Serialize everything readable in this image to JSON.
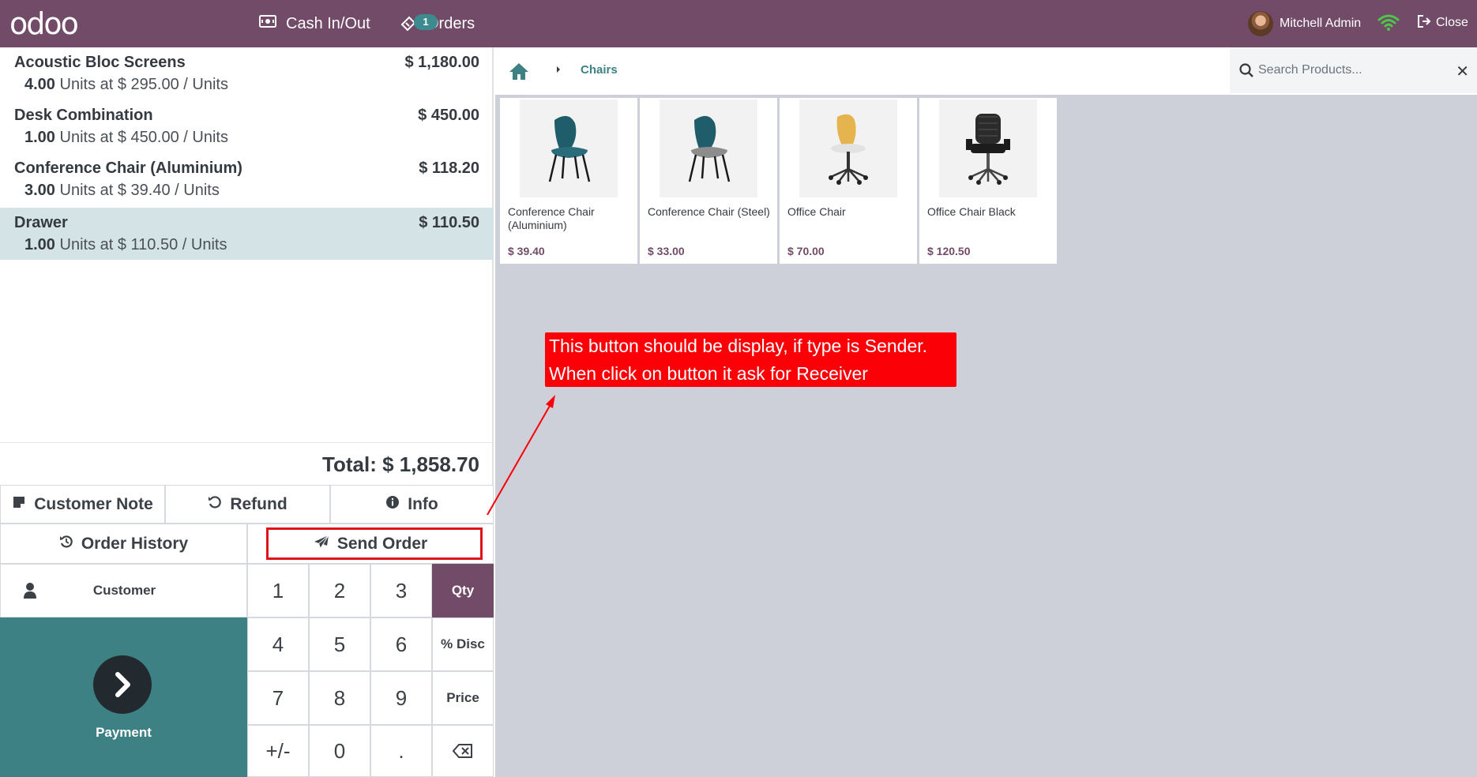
{
  "topbar": {
    "logo": "odoo",
    "cash_label": "Cash In/Out",
    "orders_label": "Orders",
    "orders_badge": "1",
    "user_name": "Mitchell Admin",
    "close_label": "Close"
  },
  "order": {
    "lines": [
      {
        "name": "Acoustic Bloc Screens",
        "price": "$ 1,180.00",
        "qty": "4.00",
        "detail": "Units at $ 295.00 / Units"
      },
      {
        "name": "Desk Combination",
        "price": "$ 450.00",
        "qty": "1.00",
        "detail": "Units at $ 450.00 / Units"
      },
      {
        "name": "Conference Chair (Aluminium)",
        "price": "$ 118.20",
        "qty": "3.00",
        "detail": "Units at $ 39.40 / Units"
      },
      {
        "name": "Drawer",
        "price": "$ 110.50",
        "qty": "1.00",
        "detail": "Units at $ 110.50 / Units"
      }
    ],
    "total": "Total: $ 1,858.70"
  },
  "controls": {
    "customer_note": "Customer Note",
    "refund": "Refund",
    "info": "Info",
    "order_history": "Order History",
    "send_order": "Send Order"
  },
  "numpad": {
    "customer": "Customer",
    "payment": "Payment",
    "keys": [
      "1",
      "2",
      "3",
      "4",
      "5",
      "6",
      "7",
      "8",
      "9",
      "+/-",
      "0",
      "."
    ],
    "modes": [
      "Qty",
      "% Disc",
      "Price"
    ]
  },
  "products": {
    "breadcrumb": "Chairs",
    "search_placeholder": "Search Products...",
    "items": [
      {
        "name": "Conference Chair (Aluminium)",
        "price": "$ 39.40"
      },
      {
        "name": "Conference Chair (Steel)",
        "price": "$ 33.00"
      },
      {
        "name": "Office Chair",
        "price": "$ 70.00"
      },
      {
        "name": "Office Chair Black",
        "price": "$ 120.50"
      }
    ]
  },
  "annotation": {
    "line1": "This button should be display, if type is Sender.",
    "line2": "When click on button it ask for Receiver"
  },
  "colors": {
    "brand": "#714b67",
    "teal": "#3d8185",
    "annotation": "#fb0007"
  }
}
